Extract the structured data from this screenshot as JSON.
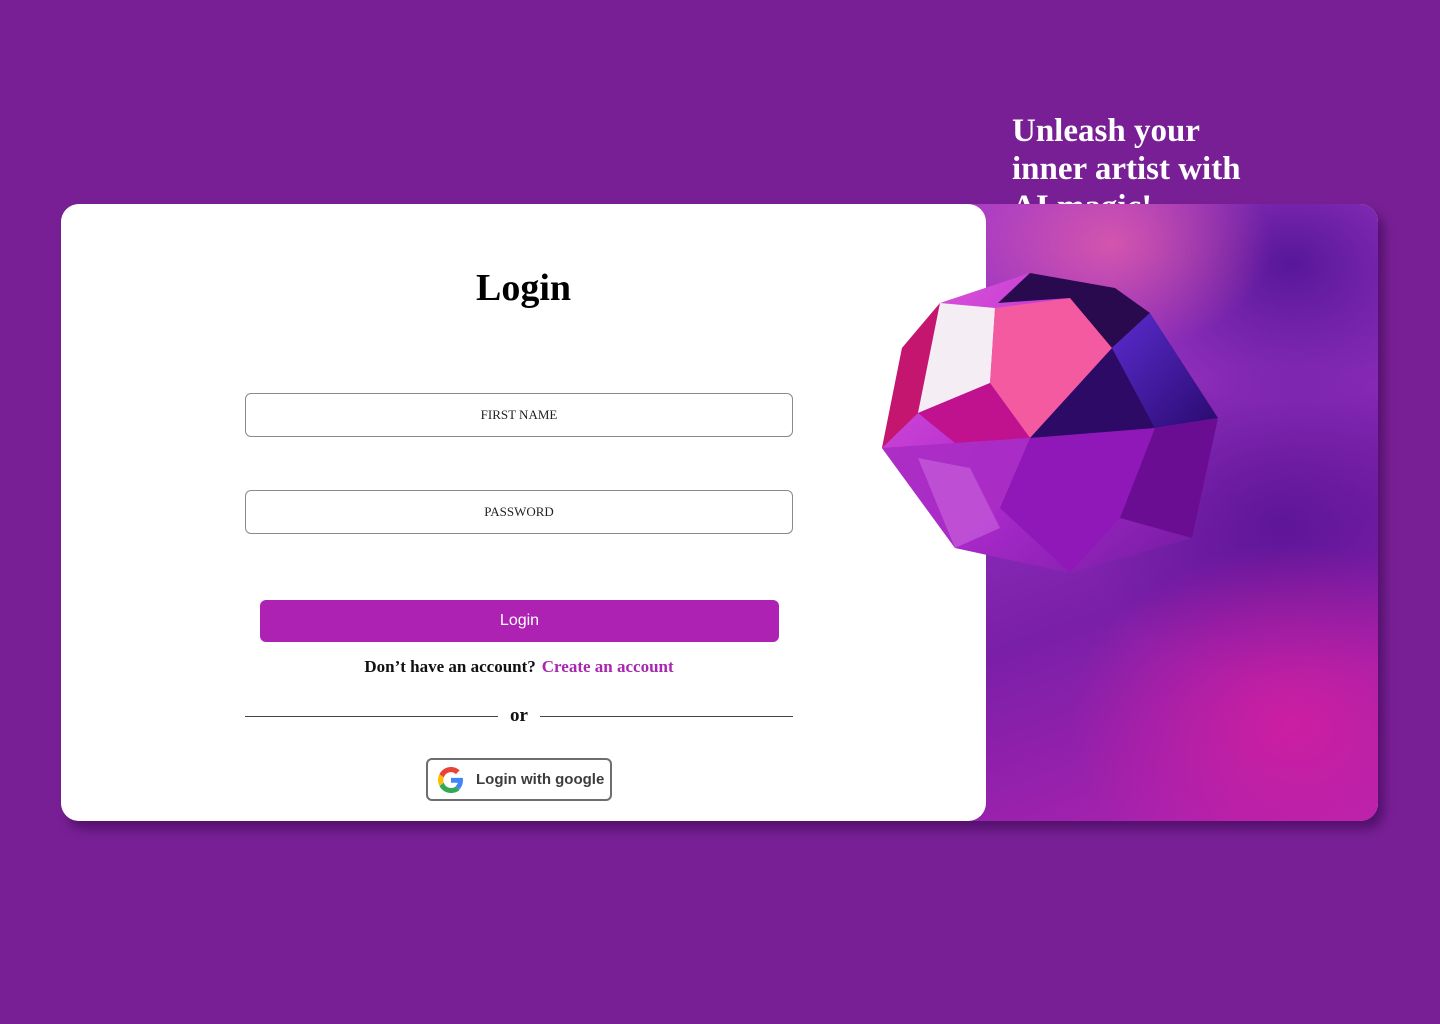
{
  "login": {
    "title": "Login",
    "first_name_placeholder": "FIRST NAME",
    "password_placeholder": "PASSWORD",
    "submit_label": "Login",
    "signup_prompt": "Don’t have an account?",
    "signup_link": "Create an account",
    "divider_text": "or",
    "google_label": "Login with google"
  },
  "hero": {
    "tagline": "Unleash your inner artist with AI magic!"
  },
  "colors": {
    "background": "#781f95",
    "accent": "#ae22b3",
    "link": "#a826b0"
  }
}
